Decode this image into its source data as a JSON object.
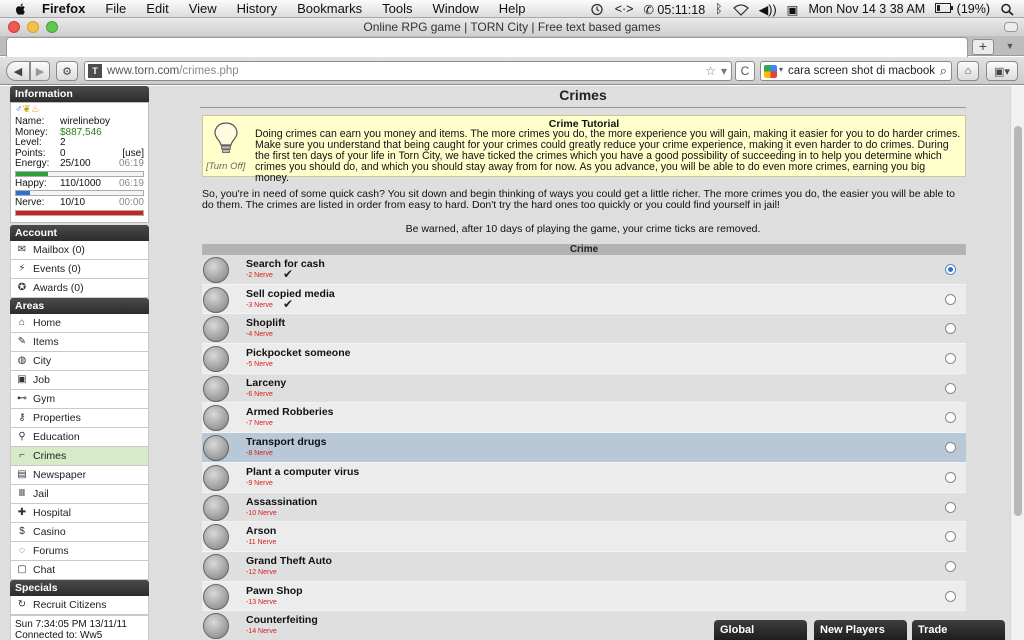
{
  "menubar": {
    "app": "Firefox",
    "items": [
      "File",
      "Edit",
      "View",
      "History",
      "Bookmarks",
      "Tools",
      "Window",
      "Help"
    ],
    "timer": "05:11:18",
    "datetime": "Mon Nov 14  3 38 AM",
    "battery": "(19%)"
  },
  "window": {
    "title": "Online RPG game | TORN City | Free text based games"
  },
  "toolbar": {
    "url_host": "www.torn.com",
    "url_path": "/crimes.php",
    "search_value": "cara screen shot di macbook"
  },
  "sidebar": {
    "information_header": "Information",
    "info": {
      "name_label": "Name:",
      "name": "wirelineboy",
      "money_label": "Money:",
      "money": "$887,546",
      "level_label": "Level:",
      "level": "2",
      "points_label": "Points:",
      "points": "0",
      "points_action": "[use]",
      "energy_label": "Energy:",
      "energy": "25/100",
      "energy_time": "06:19",
      "happy_label": "Happy:",
      "happy": "110/1000",
      "happy_time": "06:19",
      "nerve_label": "Nerve:",
      "nerve": "10/10",
      "nerve_time": "00:00"
    },
    "bars": {
      "energy_fraction": 0.25,
      "happy_fraction": 0.11,
      "nerve_fraction": 1.0,
      "energy_color": "#2ea03a",
      "happy_color": "#2f6fd6",
      "nerve_color": "#c4261b"
    },
    "account_header": "Account",
    "account_items": [
      {
        "label": "Mailbox (0)",
        "icon": "mail-icon"
      },
      {
        "label": "Events (0)",
        "icon": "lightning-icon"
      },
      {
        "label": "Awards (0)",
        "icon": "medal-icon"
      }
    ],
    "areas_header": "Areas",
    "areas_items": [
      {
        "label": "Home",
        "icon": "home-icon"
      },
      {
        "label": "Items",
        "icon": "pencil-icon"
      },
      {
        "label": "City",
        "icon": "globe-icon"
      },
      {
        "label": "Job",
        "icon": "briefcase-icon"
      },
      {
        "label": "Gym",
        "icon": "dumbbell-icon"
      },
      {
        "label": "Properties",
        "icon": "key-icon"
      },
      {
        "label": "Education",
        "icon": "pin-icon"
      },
      {
        "label": "Crimes",
        "icon": "gun-icon"
      },
      {
        "label": "Newspaper",
        "icon": "newspaper-icon"
      },
      {
        "label": "Jail",
        "icon": "bars-icon"
      },
      {
        "label": "Hospital",
        "icon": "cross-icon"
      },
      {
        "label": "Casino",
        "icon": "dollar-icon"
      },
      {
        "label": "Forums",
        "icon": "speech-icon"
      },
      {
        "label": "Chat",
        "icon": "chat-icon"
      }
    ],
    "specials_header": "Specials",
    "specials_items": [
      {
        "label": "Recruit Citizens",
        "icon": "refresh-icon"
      }
    ],
    "status": {
      "time": "Sun 7:34:05 PM 13/11/11",
      "connected": "Connected to: Ww5"
    }
  },
  "main": {
    "title": "Crimes",
    "tutorial": {
      "title": "Crime Tutorial",
      "text": "Doing crimes can earn you money and items. The more crimes you do, the more experience you will gain, making it easier for you to do harder crimes. Make sure you understand that being caught for your crimes could greatly reduce your crime experience, making it even harder to do crimes. During the first ten days of your life in Torn City, we have ticked the crimes which you have a good possibility of succeeding in to help you determine which crimes you should do, and which you should stay away from for now. As you advance, you will be able to do even more crimes, earning you big money.",
      "turn_off": "[Turn Off]"
    },
    "intro": "So, you're in need of some quick cash? You sit down and begin thinking of ways you could get a little richer. The more crimes you do, the easier you will be able to do them. The crimes are listed in order from easy to hard. Don't try the hard ones too quickly or you could find yourself in jail!",
    "warning": "Be warned, after 10 days of playing the game, your crime ticks are removed.",
    "table_header": "Crime",
    "crimes": [
      {
        "name": "Search for cash",
        "nerve": "-2 Nerve",
        "ticked": true,
        "selected": true
      },
      {
        "name": "Sell copied media",
        "nerve": "-3 Nerve",
        "ticked": true,
        "selected": false
      },
      {
        "name": "Shoplift",
        "nerve": "-4 Nerve",
        "ticked": false,
        "selected": false
      },
      {
        "name": "Pickpocket someone",
        "nerve": "-5 Nerve",
        "ticked": false,
        "selected": false
      },
      {
        "name": "Larceny",
        "nerve": "-6 Nerve",
        "ticked": false,
        "selected": false
      },
      {
        "name": "Armed Robberies",
        "nerve": "-7 Nerve",
        "ticked": false,
        "selected": false
      },
      {
        "name": "Transport drugs",
        "nerve": "-8 Nerve",
        "ticked": false,
        "selected": false
      },
      {
        "name": "Plant a computer virus",
        "nerve": "-9 Nerve",
        "ticked": false,
        "selected": false
      },
      {
        "name": "Assassination",
        "nerve": "-10 Nerve",
        "ticked": false,
        "selected": false
      },
      {
        "name": "Arson",
        "nerve": "-11 Nerve",
        "ticked": false,
        "selected": false
      },
      {
        "name": "Grand Theft Auto",
        "nerve": "-12 Nerve",
        "ticked": false,
        "selected": false
      },
      {
        "name": "Pawn Shop",
        "nerve": "-13 Nerve",
        "ticked": false,
        "selected": false
      },
      {
        "name": "Counterfeiting",
        "nerve": "-14 Nerve",
        "ticked": false,
        "selected": false
      }
    ],
    "highlight_row": 6
  },
  "chat_tabs": [
    "Global",
    "New Players",
    "Trade"
  ]
}
